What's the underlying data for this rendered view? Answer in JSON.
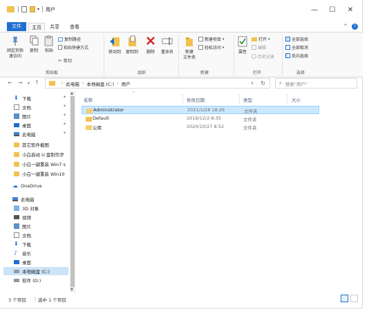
{
  "window": {
    "title": "用户"
  },
  "tabs": {
    "file": "文件",
    "home": "主页",
    "share": "共享",
    "view": "查看"
  },
  "ribbon": {
    "clipboard": {
      "pin_quick_access": "固定到快\n速访问",
      "copy": "复制",
      "paste": "粘贴",
      "copy_path": "复制路径",
      "paste_shortcut": "粘贴快捷方式",
      "cut": "剪切",
      "group_label": "剪贴板"
    },
    "organize": {
      "move_to": "移动到",
      "copy_to": "复制到",
      "delete": "删除",
      "rename": "重命名",
      "group_label": "组织"
    },
    "new": {
      "new_folder": "新建\n文件夹",
      "new_item": "新建项目",
      "easy_access": "轻松访问",
      "group_label": "新建"
    },
    "open": {
      "properties": "属性",
      "open": "打开",
      "edit": "编辑",
      "history": "历史记录",
      "group_label": "打开"
    },
    "select": {
      "select_all": "全部选择",
      "select_none": "全部取消",
      "invert": "反向选择",
      "group_label": "选择"
    }
  },
  "address": {
    "crumbs": [
      "此电脑",
      "本地磁盘 (C:)",
      "用户"
    ],
    "search_placeholder": "搜索\"用户\""
  },
  "nav_pane": {
    "quick_access": [
      {
        "label": "下载",
        "icon": "download-icon",
        "pinned": true
      },
      {
        "label": "文档",
        "icon": "document-icon",
        "pinned": true
      },
      {
        "label": "图片",
        "icon": "picture-icon",
        "pinned": true
      },
      {
        "label": "桌面",
        "icon": "desktop-icon",
        "pinned": true
      },
      {
        "label": "此电脑",
        "icon": "pc-icon",
        "pinned": true
      },
      {
        "label": "其它软件截图",
        "icon": "folder-icon"
      },
      {
        "label": "小白启动 U 盘制作步",
        "icon": "folder-icon"
      },
      {
        "label": "小白一键重装 Win7 s",
        "icon": "folder-icon"
      },
      {
        "label": "小白一键重装 Win10",
        "icon": "folder-icon"
      }
    ],
    "onedrive": "OneDrive",
    "this_pc": {
      "label": "此电脑",
      "items": [
        {
          "label": "3D 对象",
          "icon": "3d-objects-icon"
        },
        {
          "label": "视频",
          "icon": "video-icon"
        },
        {
          "label": "图片",
          "icon": "picture-icon"
        },
        {
          "label": "文档",
          "icon": "document-icon"
        },
        {
          "label": "下载",
          "icon": "download-icon"
        },
        {
          "label": "音乐",
          "icon": "music-icon"
        },
        {
          "label": "桌面",
          "icon": "desktop-icon"
        },
        {
          "label": "本地磁盘 (C:)",
          "icon": "drive-c-icon",
          "selected": true
        },
        {
          "label": "软件 (D:)",
          "icon": "drive-d-icon"
        }
      ]
    }
  },
  "file_list": {
    "columns": {
      "name": "名称",
      "date": "修改日期",
      "type": "类型",
      "size": "大小"
    },
    "rows": [
      {
        "name": "Administrator",
        "date": "2021/1/28 18:26",
        "type": "文件夹",
        "selected": true
      },
      {
        "name": "Default",
        "date": "2019/12/2 8:35",
        "type": "文件夹"
      },
      {
        "name": "公用",
        "date": "2020/10/27 8:52",
        "type": "文件夹"
      }
    ]
  },
  "status": {
    "item_count": "3 个项目",
    "selected": "选中 1 个项目"
  },
  "colors": {
    "accent": "#1f6ed0",
    "folder": "#f1c24f",
    "selection": "#cce8ff"
  }
}
